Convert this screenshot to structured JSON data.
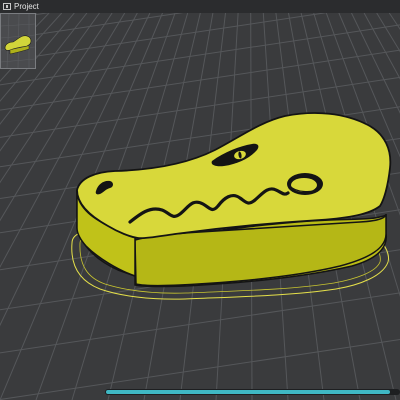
{
  "window": {
    "title": "Project"
  },
  "object_list": {
    "selected_item": "gator-head-thumbnail"
  },
  "viewport": {
    "model_name": "crocodile-head",
    "colors": {
      "background": "#3a3b3d",
      "grid_line": "#55575a",
      "model_top": "#d8d83a",
      "model_side": "#b9bb15",
      "model_outline": "#141414",
      "skirt_line": "#e5e04a"
    }
  },
  "slider": {
    "progress_fraction": 0.97
  }
}
